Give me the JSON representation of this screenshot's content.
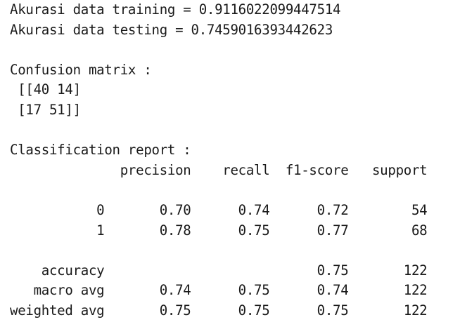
{
  "output": {
    "lines": [
      "Akurasi data training = 0.9116022099447514",
      "Akurasi data testing = 0.7459016393442623",
      "",
      "Confusion matrix :",
      " [[40 14]",
      " [17 51]]",
      "",
      "Classification report :",
      "              precision    recall  f1-score   support",
      "",
      "           0       0.70      0.74      0.72        54",
      "           1       0.78      0.75      0.77        68",
      "",
      "    accuracy                           0.75       122",
      "   macro avg       0.74      0.75      0.74       122",
      "weighted avg       0.75      0.75      0.75       122"
    ]
  }
}
